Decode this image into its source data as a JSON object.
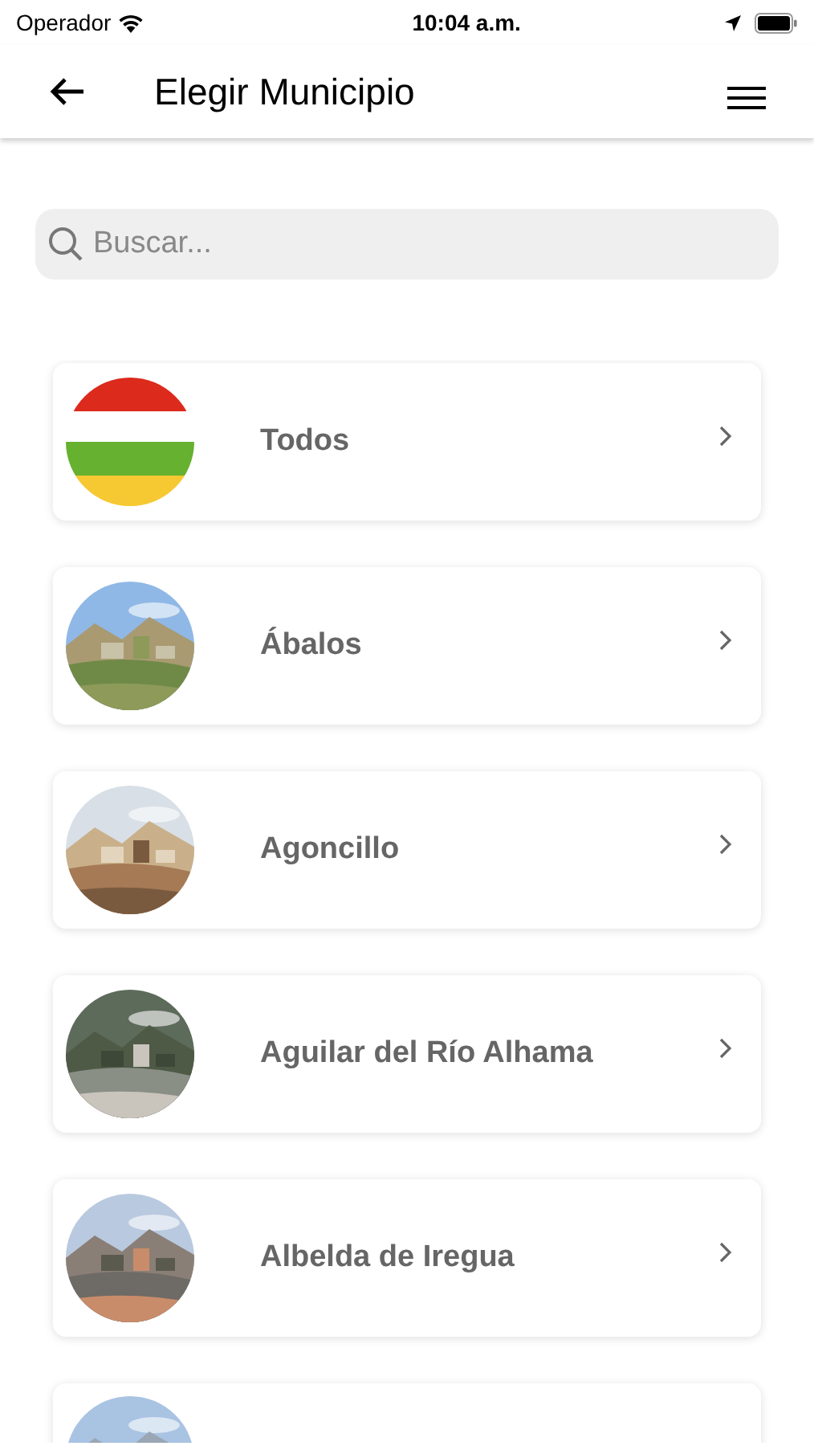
{
  "status_bar": {
    "carrier": "Operador",
    "time": "10:04 a.m."
  },
  "header": {
    "title": "Elegir Municipio"
  },
  "search": {
    "placeholder": "Buscar..."
  },
  "items": [
    {
      "kind": "flag",
      "name": "Todos"
    },
    {
      "kind": "picture",
      "name": "Ábalos"
    },
    {
      "kind": "picture",
      "name": "Agoncillo"
    },
    {
      "kind": "picture",
      "name": "Aguilar del Río Alhama"
    },
    {
      "kind": "picture",
      "name": "Albelda de Iregua"
    },
    {
      "kind": "picture"
    }
  ]
}
